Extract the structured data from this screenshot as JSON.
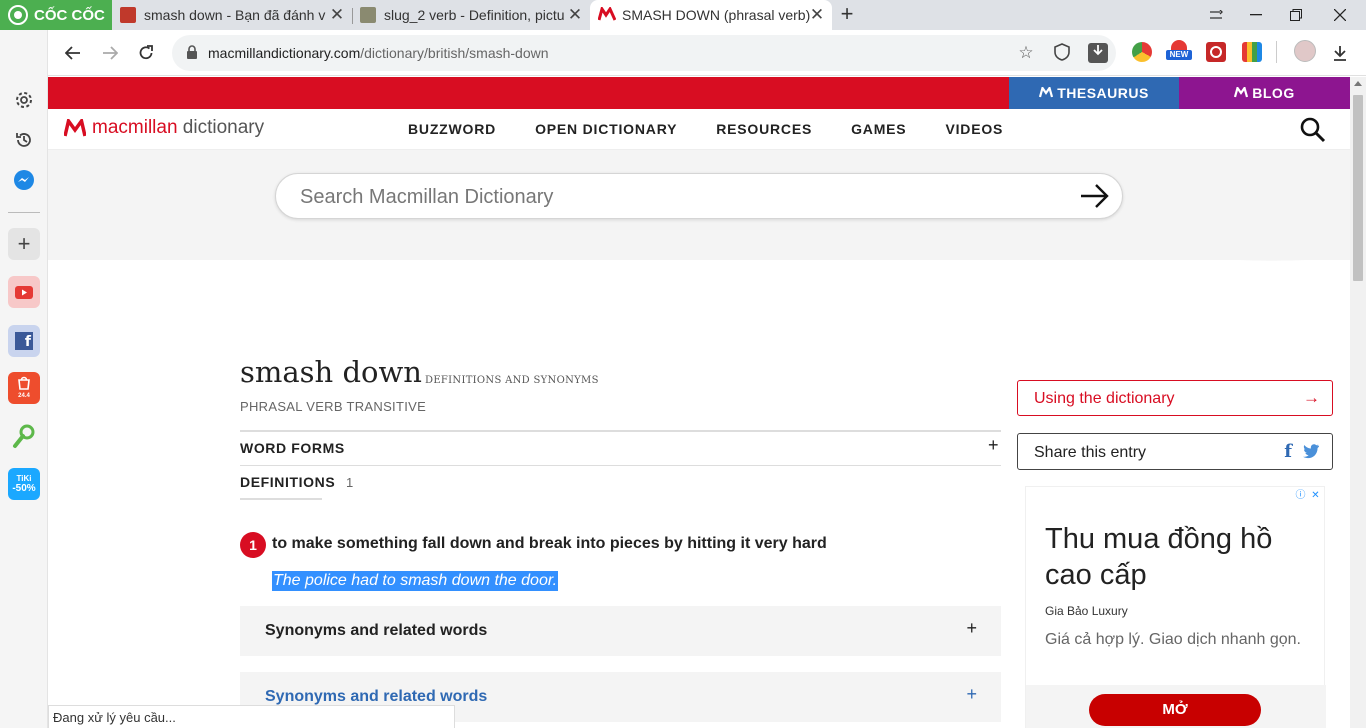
{
  "browser": {
    "brand": "CỐC CỐC",
    "tabs": [
      {
        "title": "smash down - Bạn đã đánh v",
        "favicon_color": "#c0392b"
      },
      {
        "title": "slug_2 verb - Definition, pictu",
        "favicon_color": "#8a8a70"
      },
      {
        "title": "SMASH DOWN (phrasal verb)",
        "favicon_color": "#d80d22"
      }
    ],
    "address": {
      "host": "macmillandictionary.com",
      "path": "/dictionary/british/smash-down"
    },
    "extensions": [
      "coccoc-ext-icon",
      "new-badge-icon",
      "red-ext-icon",
      "palette-ext-icon"
    ],
    "ext_new_label": "NEW",
    "status_text": "Đang xử lý yêu cầu..."
  },
  "sidebar": {
    "items": [
      "settings-icon",
      "history-icon",
      "messenger-icon",
      "add-icon",
      "youtube-icon",
      "facebook-icon",
      "shopee-icon",
      "map-icon",
      "tiki-icon"
    ],
    "shopee_label": "24.4",
    "tiki_label_top": "TiKi",
    "tiki_label_bottom": "-50%"
  },
  "site": {
    "thesaurus": "THESAURUS",
    "blog": "BLOG",
    "logo_part1": "macmillan",
    "logo_part2": " dictionary",
    "nav": [
      "BUZZWORD",
      "OPEN DICTIONARY",
      "RESOURCES",
      "GAMES",
      "VIDEOS"
    ],
    "search_placeholder": "Search Macmillan Dictionary",
    "accent_red": "#d80d22",
    "thesaurus_blue": "#2f69b3",
    "blog_purple": "#8d1590"
  },
  "entry": {
    "headword": "smash down",
    "headword_sub": "DEFINITIONS AND SYNONYMS",
    "pos": "PHRASAL VERB  TRANSITIVE",
    "word_forms": "WORD FORMS",
    "definitions_label": "DEFINITIONS",
    "definitions_count": "1",
    "sense_number": "1",
    "definition": "to make something fall down and break into pieces by hitting it very hard",
    "example": "The police had to smash down the door.",
    "synonyms_1": "Synonyms and related words",
    "synonyms_2": "Synonyms and related words"
  },
  "right": {
    "using": "Using the dictionary",
    "share": "Share this entry",
    "ad": {
      "headline": "Thu mua đồng hồ cao cấp",
      "source": "Gia Bảo Luxury",
      "description": "Giá cả hợp lý. Giao dịch nhanh gọn.",
      "cta": "MỞ"
    }
  }
}
